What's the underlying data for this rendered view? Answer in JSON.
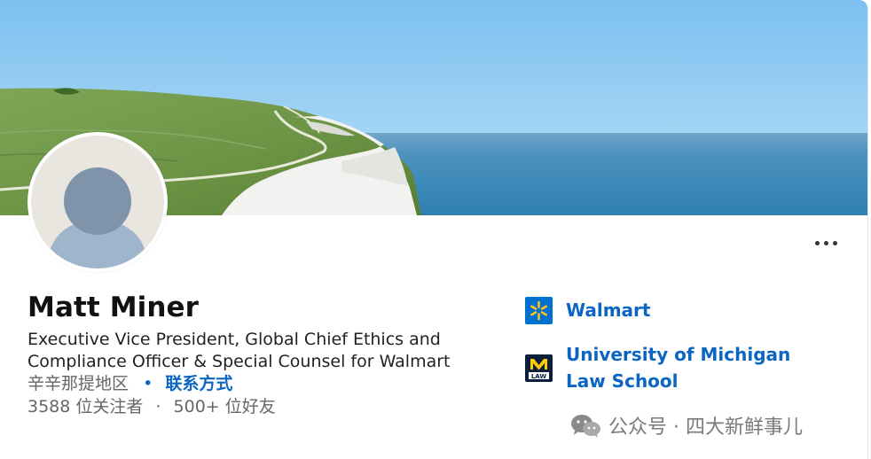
{
  "profile": {
    "name": "Matt Miner",
    "headline": "Executive Vice President, Global Chief Ethics and Compliance Officer & Special Counsel for Walmart",
    "location": "辛辛那提地区",
    "bullet": "•",
    "contact_info": "联系方式",
    "followers": "3588 位关注者",
    "separator": "·",
    "connections": "500+ 位好友"
  },
  "organizations": [
    {
      "name": "Walmart",
      "logo": "walmart-logo-icon"
    },
    {
      "name": "University of Michigan Law School",
      "logo": "michigan-law-logo-icon"
    }
  ],
  "actions": {
    "more_icon": "more-horizontal-icon"
  },
  "watermark": {
    "text": "公众号 · 四大新鲜事儿",
    "icon": "wechat-icon"
  },
  "colors": {
    "link": "#0a66c2",
    "sky": "#89c4ef",
    "sea": "#3a8ab8",
    "grass": "#6f9c43",
    "cliff": "#f0f0f0",
    "avatar_bg": "#e9e5df",
    "avatar_figure": "#7f93aa"
  }
}
